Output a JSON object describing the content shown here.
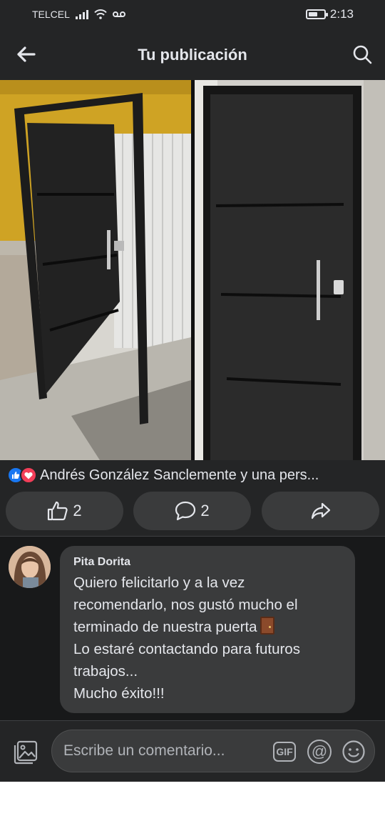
{
  "status_bar": {
    "carrier": "TELCEL",
    "time": "2:13",
    "battery_level": 0.6
  },
  "header": {
    "title": "Tu publicación",
    "back_icon": "arrow-left-icon",
    "search_icon": "search-icon"
  },
  "post": {
    "image_description_icon": "photo",
    "reactions_text": "Andrés González Sanclemente y una pers...",
    "reaction_icons": [
      "like-icon",
      "love-icon"
    ],
    "actions": {
      "like_count": "2",
      "comment_count": "2",
      "share_icon": "share-icon"
    }
  },
  "comment": {
    "author": "Pita Dorita",
    "lines": [
      "Quiero felicitarlo y a la vez",
      "recomendarlo, nos gustó mucho el",
      "terminado de nuestra puerta",
      "Lo estaré contactando para futuros",
      "trabajos...",
      "Mucho éxito!!!"
    ]
  },
  "composer": {
    "placeholder": "Escribe un comentario...",
    "gif_label": "GIF",
    "mention_label": "@"
  },
  "colors": {
    "background": "#242526",
    "surface": "#3a3b3c",
    "text": "#e4e6eb",
    "like_blue": "#1877f2",
    "love_red": "#f33e58"
  }
}
